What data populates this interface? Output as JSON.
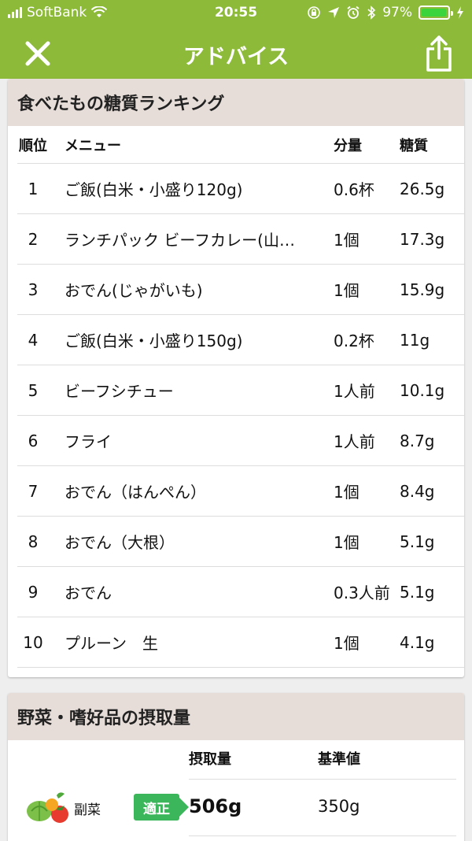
{
  "status": {
    "carrier": "SoftBank",
    "time": "20:55",
    "battery": "97%",
    "battery_level": 0.97
  },
  "nav": {
    "title": "アドバイス"
  },
  "ranking": {
    "title": "食べたもの糖質ランキング",
    "headers": {
      "rank": "順位",
      "menu": "メニュー",
      "amount": "分量",
      "carbs": "糖質"
    },
    "rows": [
      {
        "rank": "1",
        "menu": "ご飯(白米・小盛り120g)",
        "amount": "0.6杯",
        "carbs": "26.5g"
      },
      {
        "rank": "2",
        "menu": "ランチパック ビーフカレー(山…",
        "amount": "1個",
        "carbs": "17.3g"
      },
      {
        "rank": "3",
        "menu": "おでん(じゃがいも)",
        "amount": "1個",
        "carbs": "15.9g"
      },
      {
        "rank": "4",
        "menu": "ご飯(白米・小盛り150g)",
        "amount": "0.2杯",
        "carbs": "11g"
      },
      {
        "rank": "5",
        "menu": "ビーフシチュー",
        "amount": "1人前",
        "carbs": "10.1g"
      },
      {
        "rank": "6",
        "menu": "フライ",
        "amount": "1人前",
        "carbs": "8.7g"
      },
      {
        "rank": "7",
        "menu": "おでん（はんぺん）",
        "amount": "1個",
        "carbs": "8.4g"
      },
      {
        "rank": "8",
        "menu": "おでん（大根）",
        "amount": "1個",
        "carbs": "5.1g"
      },
      {
        "rank": "9",
        "menu": "おでん",
        "amount": "0.3人前",
        "carbs": "5.1g"
      },
      {
        "rank": "10",
        "menu": "プルーン　生",
        "amount": "1個",
        "carbs": "4.1g"
      }
    ]
  },
  "intake": {
    "title": "野菜・嗜好品の摂取量",
    "headers": {
      "intake": "摂取量",
      "standard": "基準値"
    },
    "rows": [
      {
        "label": "副菜",
        "badge": "適正",
        "value": "506g",
        "standard": "350g"
      }
    ]
  },
  "colors": {
    "header_green": "#8dbb39",
    "badge_green": "#3cb65a",
    "section_header": "#e7ddd8"
  }
}
